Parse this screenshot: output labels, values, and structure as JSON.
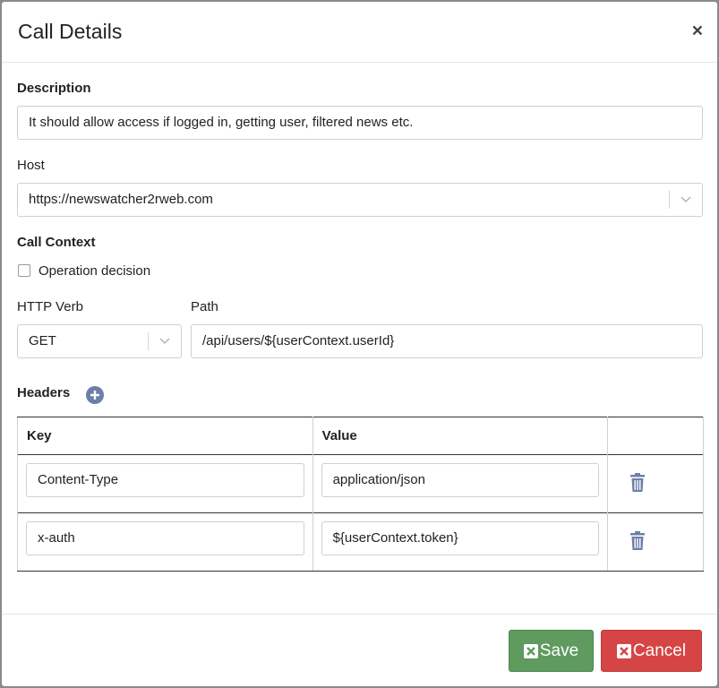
{
  "modal": {
    "title": "Call Details",
    "close_glyph": "×"
  },
  "description": {
    "label": "Description",
    "value": "It should allow access if logged in, getting user, filtered news etc."
  },
  "host": {
    "label": "Host",
    "value": "https://newswatcher2rweb.com"
  },
  "call_context": {
    "label": "Call Context",
    "operation_decision": {
      "label": "Operation decision",
      "checked": false
    }
  },
  "http_verb": {
    "label": "HTTP Verb",
    "value": "GET"
  },
  "path": {
    "label": "Path",
    "value": "/api/users/${userContext.userId}"
  },
  "headers": {
    "label": "Headers",
    "columns": [
      "Key",
      "Value",
      ""
    ],
    "rows": [
      {
        "key": "Content-Type",
        "value": "application/json"
      },
      {
        "key": "x-auth",
        "value": "${userContext.token}"
      }
    ]
  },
  "footer": {
    "save_label": "Save",
    "cancel_label": "Cancel"
  },
  "colors": {
    "save": "#5f9a5f",
    "cancel": "#d64545",
    "icon_blue": "#6d7fa8"
  },
  "icons": {
    "close": "close-icon",
    "add": "plus-circle-icon",
    "delete": "trash-icon",
    "dropdown": "chevron-down-icon"
  }
}
